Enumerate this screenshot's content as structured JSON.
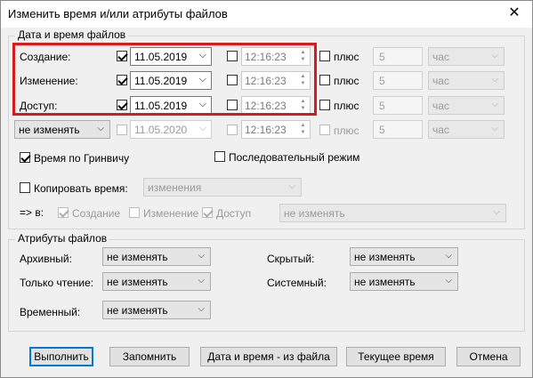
{
  "window": {
    "title": "Изменить время и/или атрибуты файлов",
    "close_glyph": "✕"
  },
  "datetime_group": {
    "label": "Дата и время файлов",
    "rows": [
      {
        "label": "Создание:",
        "date": "11.05.2019",
        "time": "12:16:23",
        "plus": "плюс",
        "num": "5",
        "unit": "час"
      },
      {
        "label": "Изменение:",
        "date": "11.05.2019",
        "time": "12:16:23",
        "plus": "плюс",
        "num": "5",
        "unit": "час"
      },
      {
        "label": "Доступ:",
        "date": "11.05.2019",
        "time": "12:16:23",
        "plus": "плюс",
        "num": "5",
        "unit": "час"
      },
      {
        "combo": "не изменять",
        "date": "11.05.2020",
        "time": "12:16:23",
        "plus": "плюс",
        "num": "5",
        "unit": "час"
      }
    ],
    "gmt": "Время по Гринвичу",
    "sequential": "Последовательный режим",
    "copy_time": "Копировать время:",
    "copy_source": "изменения",
    "to_label": "=> в:",
    "to_creation": "Создание",
    "to_modify": "Изменение",
    "to_access": "Доступ",
    "to_combo": "не изменять"
  },
  "attrs_group": {
    "label": "Атрибуты файлов",
    "archive": "Архивный:",
    "readonly": "Только чтение:",
    "temporary": "Временный:",
    "hidden": "Скрытый:",
    "system": "Системный:",
    "value": "не изменять"
  },
  "buttons": {
    "run": "Выполнить",
    "remember": "Запомнить",
    "from_file": "Дата и время - из файла",
    "current": "Текущее время",
    "cancel": "Отмена"
  },
  "icons": {
    "dropdown": "⌵",
    "spin_up": "▲",
    "spin_down": "▼"
  }
}
